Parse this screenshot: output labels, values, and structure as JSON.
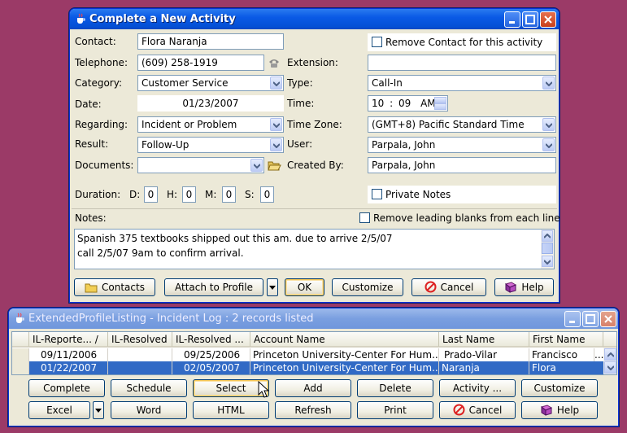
{
  "activity_window": {
    "title": "Complete a New Activity",
    "contact_label": "Contact:",
    "contact_value": "Flora Naranja",
    "remove_contact_label": "Remove Contact for this activity",
    "telephone_label": "Telephone:",
    "telephone_value": "(609) 258-1919",
    "extension_label": "Extension:",
    "extension_value": "",
    "category_label": "Category:",
    "category_value": "Customer Service",
    "type_label": "Type:",
    "type_value": "Call-In",
    "date_label": "Date:",
    "date_value": "01/23/2007",
    "time_label": "Time:",
    "time_hour": "10",
    "time_sep": ":",
    "time_min": "09",
    "time_ampm": "AM",
    "regarding_label": "Regarding:",
    "regarding_value": "Incident or Problem",
    "timezone_label": "Time Zone:",
    "timezone_value": "(GMT+8) Pacific Standard Time",
    "result_label": "Result:",
    "result_value": "Follow-Up",
    "user_label": "User:",
    "user_value": "Parpala, John",
    "documents_label": "Documents:",
    "documents_value": "",
    "created_by_label": "Created By:",
    "created_by_value": "Parpala, John",
    "duration_label": "Duration:",
    "dur_d_label": "D:",
    "dur_d": "0",
    "dur_h_label": "H:",
    "dur_h": "0",
    "dur_m_label": "M:",
    "dur_m": "0",
    "dur_s_label": "S:",
    "dur_s": "0",
    "private_notes_label": "Private Notes",
    "notes_label": "Notes:",
    "remove_blanks_label": "Remove leading blanks from each line",
    "notes_line1": "Spanish 375 textbooks shipped out this am. due to arrive 2/5/07",
    "notes_line2": "call 2/5/07 9am to confirm arrival.",
    "buttons": {
      "contacts": "Contacts",
      "attach": "Attach to Profile",
      "ok": "OK",
      "customize": "Customize",
      "cancel": "Cancel",
      "help": "Help"
    }
  },
  "listing_window": {
    "title": "ExtendedProfileListing - Incident Log : 2 records listed",
    "columns": [
      "IL-Reporte... /",
      "IL-Resolved",
      "IL-Resolved ...",
      "Account Name",
      "Last Name",
      "First Name"
    ],
    "rows": [
      [
        "09/11/2006",
        "",
        "09/25/2006",
        "Princeton University-Center For Hum...",
        "Prado-Vilar",
        "Francisco"
      ],
      [
        "01/22/2007",
        "",
        "02/05/2007",
        "Princeton University-Center For Hum...",
        "Naranja",
        "Flora"
      ]
    ],
    "row_overflow": "...",
    "buttons_row1": [
      "Complete",
      "Schedule",
      "Select",
      "Add",
      "Delete",
      "Activity ...",
      "Customize"
    ],
    "buttons_row2": [
      "Excel",
      "Word",
      "HTML",
      "Refresh",
      "Print",
      "Cancel",
      "Help"
    ]
  },
  "colors": {
    "desktop": "#9b3a67",
    "titlebar_active": "#0a5ae6",
    "selection": "#316ac5"
  }
}
